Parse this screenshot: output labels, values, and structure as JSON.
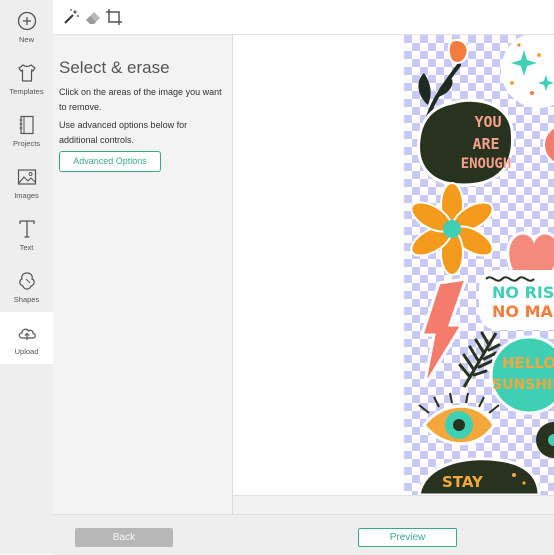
{
  "nav": {
    "items": [
      {
        "label": "New",
        "icon": "plus-circle-icon"
      },
      {
        "label": "Templates",
        "icon": "tshirt-icon"
      },
      {
        "label": "Projects",
        "icon": "notebook-icon"
      },
      {
        "label": "Images",
        "icon": "image-icon"
      },
      {
        "label": "Text",
        "icon": "text-t-icon"
      },
      {
        "label": "Shapes",
        "icon": "shapes-icon"
      },
      {
        "label": "Upload",
        "icon": "cloud-upload-icon"
      }
    ],
    "active": "Upload"
  },
  "toolbar": {
    "tools": [
      "magic-wand-icon",
      "eraser-icon",
      "crop-icon"
    ]
  },
  "panel": {
    "title": "Select & erase",
    "instruction": "Click on the areas of the image you want to remove.",
    "advanced_hint": "Use advanced options below for additional controls.",
    "advanced_button": "Advanced Options"
  },
  "canvas": {
    "stickers": {
      "you_are_enough": [
        "YOU",
        "ARE",
        "ENOUGH"
      ],
      "no_risk": [
        "NO RIS",
        "NO MA"
      ],
      "hello_sunshine": [
        "HELLO",
        "SUNSHIN"
      ],
      "stay": [
        "STAY"
      ]
    }
  },
  "footer": {
    "back_label": "Back",
    "preview_label": "Preview"
  },
  "colors": {
    "accent": "#3ba88d",
    "rail_bg": "#eeeeee",
    "panel_bg": "#f3f3f3",
    "checker_blue": "#c9c9f5"
  }
}
